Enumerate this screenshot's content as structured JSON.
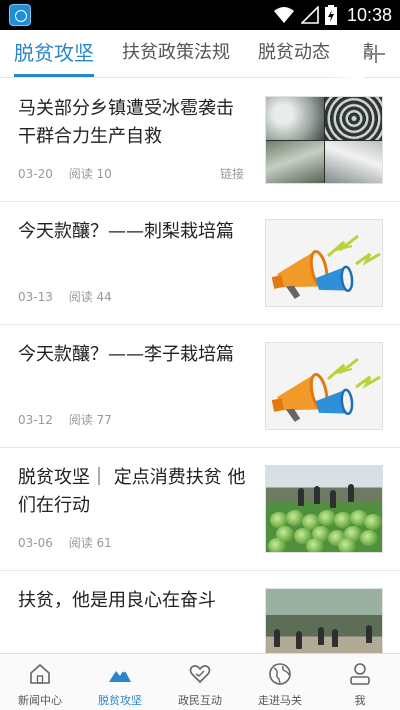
{
  "status_bar": {
    "time": "10:38"
  },
  "tabs": {
    "items": [
      {
        "label": "脱贫攻坚",
        "active": true
      },
      {
        "label": "扶贫政策法规",
        "active": false
      },
      {
        "label": "脱贫动态",
        "active": false
      },
      {
        "label": "精",
        "active": false
      }
    ],
    "accent_color": "#2a86cc"
  },
  "news": [
    {
      "title": "马关部分乡镇遭受冰雹袭击 干群合力生产自救",
      "date": "03-20",
      "reads": "阅读 10",
      "link": "链接",
      "thumb": "hail-damage-photo"
    },
    {
      "title": "今天款釀？——刺梨栽培篇",
      "date": "03-13",
      "reads": "阅读 44",
      "thumb": "megaphone-illustration"
    },
    {
      "title": "今天款釀？——李子栽培篇",
      "date": "03-12",
      "reads": "阅读 77",
      "thumb": "megaphone-illustration"
    },
    {
      "title": "脱贫攻坚｜ 定点消费扶贫 他们在行动",
      "date": "03-06",
      "reads": "阅读 61",
      "thumb": "cabbage-harvest-photo"
    },
    {
      "title": "扶贫，他是用良心在奋斗",
      "date": "",
      "reads": "",
      "thumb": "village-road-photo"
    }
  ],
  "bottom_nav": [
    {
      "label": "新闻中心",
      "icon": "home-icon",
      "active": false
    },
    {
      "label": "脱贫攻坚",
      "icon": "mountain-icon",
      "active": true
    },
    {
      "label": "政民互动",
      "icon": "heart-hands-icon",
      "active": false
    },
    {
      "label": "走进马关",
      "icon": "globe-icon",
      "active": false
    },
    {
      "label": "我",
      "icon": "person-icon",
      "active": false
    }
  ]
}
